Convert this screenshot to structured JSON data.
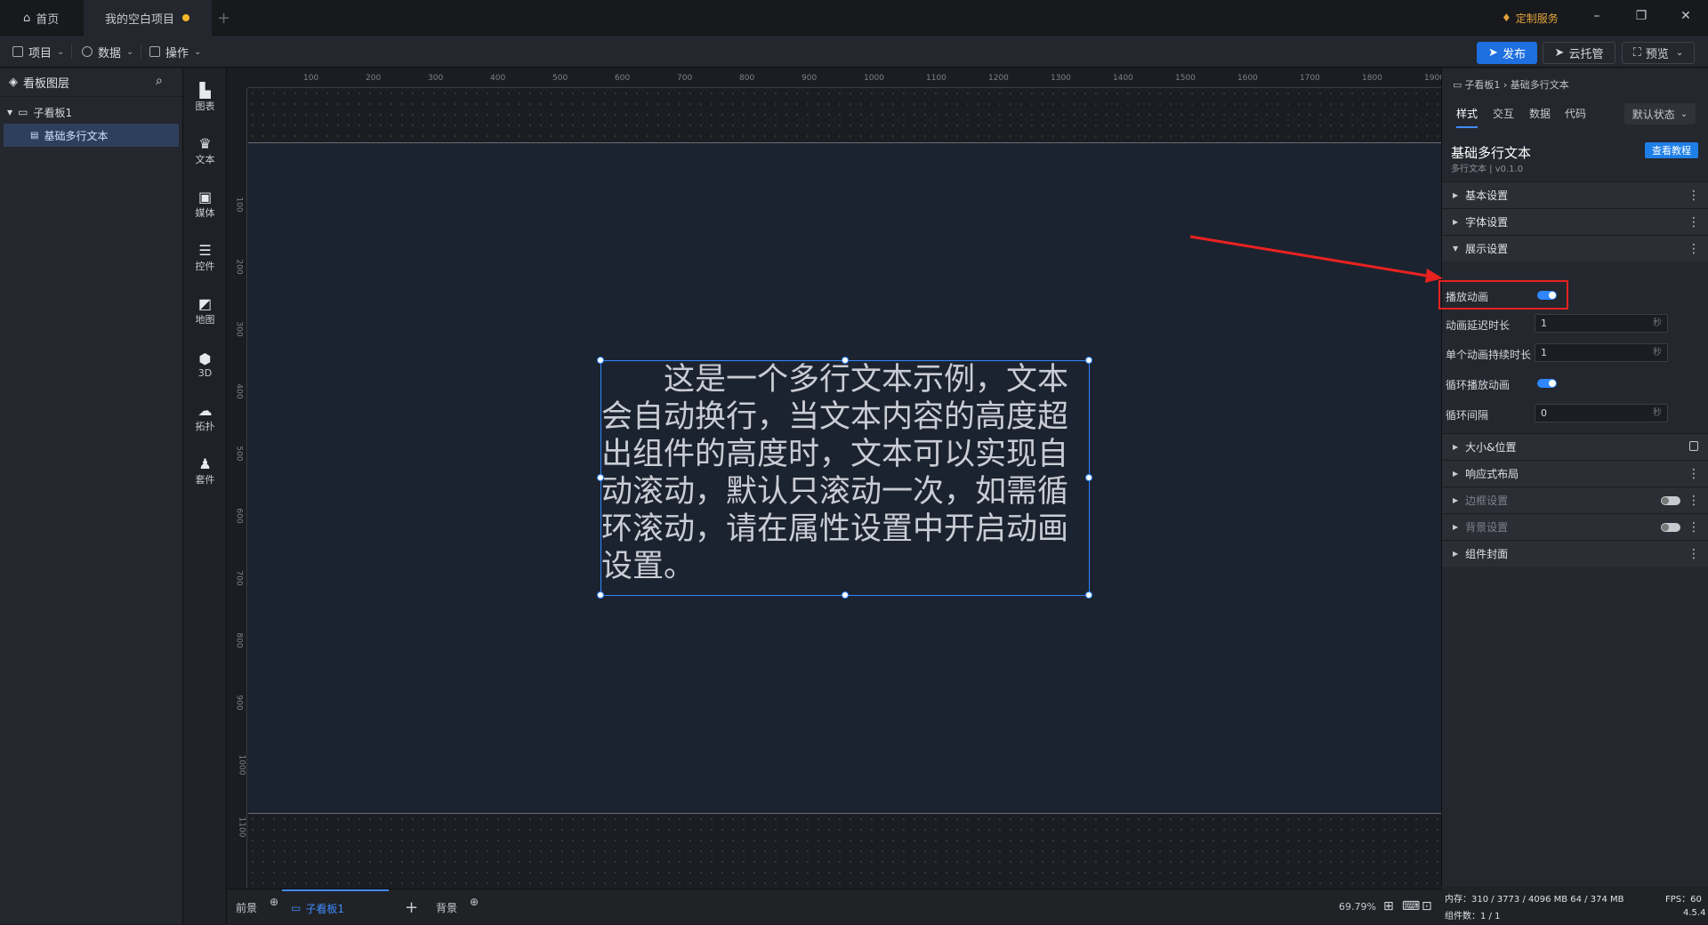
{
  "titlebar": {
    "home_label": "首页",
    "project_tab": "我的空白项目",
    "custom_service": "定制服务"
  },
  "menubar": {
    "project": "项目",
    "data": "数据",
    "operate": "操作",
    "publish": "发布",
    "cloud_host": "云托管",
    "preview": "预览"
  },
  "layers": {
    "title": "看板图层",
    "board": "子看板1",
    "component": "基础多行文本"
  },
  "toolbar": [
    "图表",
    "文本",
    "媒体",
    "控件",
    "地图",
    "3D",
    "拓扑",
    "套件"
  ],
  "ruler": {
    "top": [
      "100",
      "200",
      "300",
      "400",
      "500",
      "600",
      "700",
      "800",
      "900",
      "1000",
      "1100",
      "1200",
      "1300",
      "1400",
      "1500",
      "1600",
      "1700",
      "1800",
      "1900"
    ],
    "left": [
      "100",
      "200",
      "300",
      "400",
      "500",
      "600",
      "700",
      "800",
      "900",
      "1000",
      "1100"
    ]
  },
  "canvas": {
    "text": "这是一个多行文本示例，文本会自动换行，当文本内容的高度超出组件的高度时，文本可以实现自动滚动，默认只滚动一次，如需循环滚动，请在属性设置中开启动画设置。"
  },
  "bottom": {
    "foreground": "前景",
    "board_tab": "子看板1",
    "background": "背景",
    "zoom": "69.79%"
  },
  "panel": {
    "breadcrumb": "子看板1 › 基础多行文本",
    "tabs": [
      "样式",
      "交互",
      "数据",
      "代码"
    ],
    "state": "默认状态",
    "title": "基础多行文本",
    "subtitle": "多行文本 | v0.1.0",
    "tutorial": "查看教程",
    "sections": {
      "basic": "基本设置",
      "font": "字体设置",
      "display": "展示设置",
      "size": "大小&位置",
      "responsive": "响应式布局",
      "border": "边框设置",
      "bg": "背景设置",
      "cover": "组件封面"
    },
    "rows": {
      "play_anim": "播放动画",
      "delay": "动画延迟时长",
      "delay_val": "1",
      "duration": "单个动画持续时长",
      "duration_val": "1",
      "loop": "循环播放动画",
      "interval": "循环间隔",
      "interval_val": "0",
      "unit": "秒"
    }
  },
  "status": {
    "memory": "内存：310 / 3773 / 4096 MB  64 / 374 MB",
    "fps": "FPS：60",
    "count": "组件数：1 / 1",
    "version": "4.5.4"
  }
}
